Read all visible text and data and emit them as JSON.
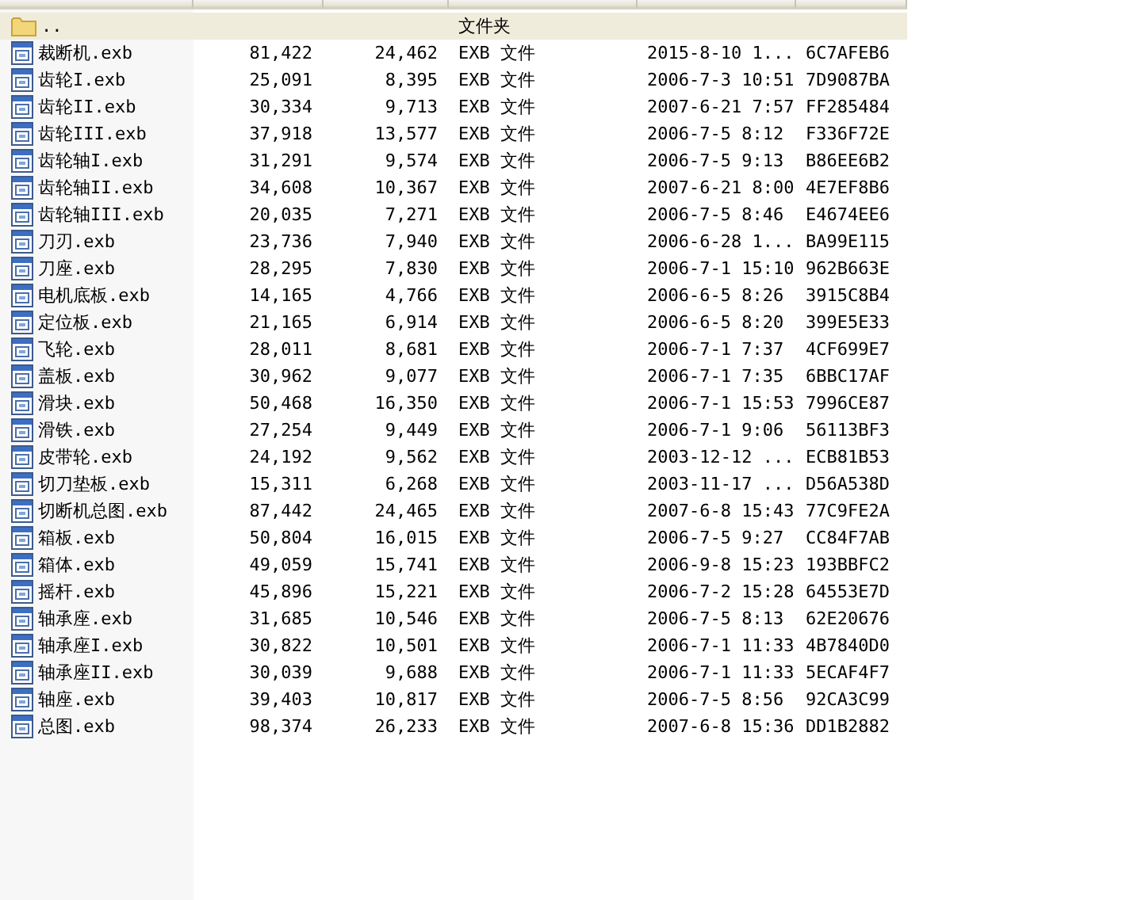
{
  "rows": [
    {
      "kind": "folder",
      "selected": true,
      "name": "..",
      "type": "文件夹"
    },
    {
      "kind": "file",
      "selected": false,
      "cells": [
        "裁断机.exb",
        "81,422",
        "24,462",
        "EXB 文件",
        "2015-8-10 1...",
        "6C7AFEB6"
      ]
    },
    {
      "kind": "file",
      "selected": false,
      "cells": [
        "齿轮I.exb",
        "25,091",
        "8,395",
        "EXB 文件",
        "2006-7-3 10:51",
        "7D9087BA"
      ]
    },
    {
      "kind": "file",
      "selected": false,
      "cells": [
        "齿轮II.exb",
        "30,334",
        "9,713",
        "EXB 文件",
        "2007-6-21 7:57",
        "FF285484"
      ]
    },
    {
      "kind": "file",
      "selected": false,
      "cells": [
        "齿轮III.exb",
        "37,918",
        "13,577",
        "EXB 文件",
        "2006-7-5 8:12",
        "F336F72E"
      ]
    },
    {
      "kind": "file",
      "selected": false,
      "cells": [
        "齿轮轴I.exb",
        "31,291",
        "9,574",
        "EXB 文件",
        "2006-7-5 9:13",
        "B86EE6B2"
      ]
    },
    {
      "kind": "file",
      "selected": false,
      "cells": [
        "齿轮轴II.exb",
        "34,608",
        "10,367",
        "EXB 文件",
        "2007-6-21 8:00",
        "4E7EF8B6"
      ]
    },
    {
      "kind": "file",
      "selected": false,
      "cells": [
        "齿轮轴III.exb",
        "20,035",
        "7,271",
        "EXB 文件",
        "2006-7-5 8:46",
        "E4674EE6"
      ]
    },
    {
      "kind": "file",
      "selected": false,
      "cells": [
        "刀刃.exb",
        "23,736",
        "7,940",
        "EXB 文件",
        "2006-6-28 1...",
        "BA99E115"
      ]
    },
    {
      "kind": "file",
      "selected": false,
      "cells": [
        "刀座.exb",
        "28,295",
        "7,830",
        "EXB 文件",
        "2006-7-1 15:10",
        "962B663E"
      ]
    },
    {
      "kind": "file",
      "selected": false,
      "cells": [
        "电机底板.exb",
        "14,165",
        "4,766",
        "EXB 文件",
        "2006-6-5 8:26",
        "3915C8B4"
      ]
    },
    {
      "kind": "file",
      "selected": false,
      "cells": [
        "定位板.exb",
        "21,165",
        "6,914",
        "EXB 文件",
        "2006-6-5 8:20",
        "399E5E33"
      ]
    },
    {
      "kind": "file",
      "selected": false,
      "cells": [
        "飞轮.exb",
        "28,011",
        "8,681",
        "EXB 文件",
        "2006-7-1 7:37",
        "4CF699E7"
      ]
    },
    {
      "kind": "file",
      "selected": false,
      "cells": [
        "盖板.exb",
        "30,962",
        "9,077",
        "EXB 文件",
        "2006-7-1 7:35",
        "6BBC17AF"
      ]
    },
    {
      "kind": "file",
      "selected": false,
      "cells": [
        "滑块.exb",
        "50,468",
        "16,350",
        "EXB 文件",
        "2006-7-1 15:53",
        "7996CE87"
      ]
    },
    {
      "kind": "file",
      "selected": false,
      "cells": [
        "滑铁.exb",
        "27,254",
        "9,449",
        "EXB 文件",
        "2006-7-1 9:06",
        "56113BF3"
      ]
    },
    {
      "kind": "file",
      "selected": false,
      "cells": [
        "皮带轮.exb",
        "24,192",
        "9,562",
        "EXB 文件",
        "2003-12-12 ...",
        "ECB81B53"
      ]
    },
    {
      "kind": "file",
      "selected": false,
      "cells": [
        "切刀垫板.exb",
        "15,311",
        "6,268",
        "EXB 文件",
        "2003-11-17 ...",
        "D56A538D"
      ]
    },
    {
      "kind": "file",
      "selected": false,
      "cells": [
        "切断机总图.exb",
        "87,442",
        "24,465",
        "EXB 文件",
        "2007-6-8 15:43",
        "77C9FE2A"
      ]
    },
    {
      "kind": "file",
      "selected": false,
      "cells": [
        "箱板.exb",
        "50,804",
        "16,015",
        "EXB 文件",
        "2006-7-5 9:27",
        "CC84F7AB"
      ]
    },
    {
      "kind": "file",
      "selected": false,
      "cells": [
        "箱体.exb",
        "49,059",
        "15,741",
        "EXB 文件",
        "2006-9-8 15:23",
        "193BBFC2"
      ]
    },
    {
      "kind": "file",
      "selected": false,
      "cells": [
        "摇杆.exb",
        "45,896",
        "15,221",
        "EXB 文件",
        "2006-7-2 15:28",
        "64553E7D"
      ]
    },
    {
      "kind": "file",
      "selected": false,
      "cells": [
        "轴承座.exb",
        "31,685",
        "10,546",
        "EXB 文件",
        "2006-7-5 8:13",
        "62E20676"
      ]
    },
    {
      "kind": "file",
      "selected": false,
      "cells": [
        "轴承座I.exb",
        "30,822",
        "10,501",
        "EXB 文件",
        "2006-7-1 11:33",
        "4B7840D0"
      ]
    },
    {
      "kind": "file",
      "selected": false,
      "cells": [
        "轴承座II.exb",
        "30,039",
        "9,688",
        "EXB 文件",
        "2006-7-1 11:33",
        "5ECAF4F7"
      ]
    },
    {
      "kind": "file",
      "selected": false,
      "cells": [
        "轴座.exb",
        "39,403",
        "10,817",
        "EXB 文件",
        "2006-7-5 8:56",
        "92CA3C99"
      ]
    },
    {
      "kind": "file",
      "selected": false,
      "cells": [
        "总图.exb",
        "98,374",
        "26,233",
        "EXB 文件",
        "2007-6-8 15:36",
        "DD1B2882"
      ]
    }
  ]
}
